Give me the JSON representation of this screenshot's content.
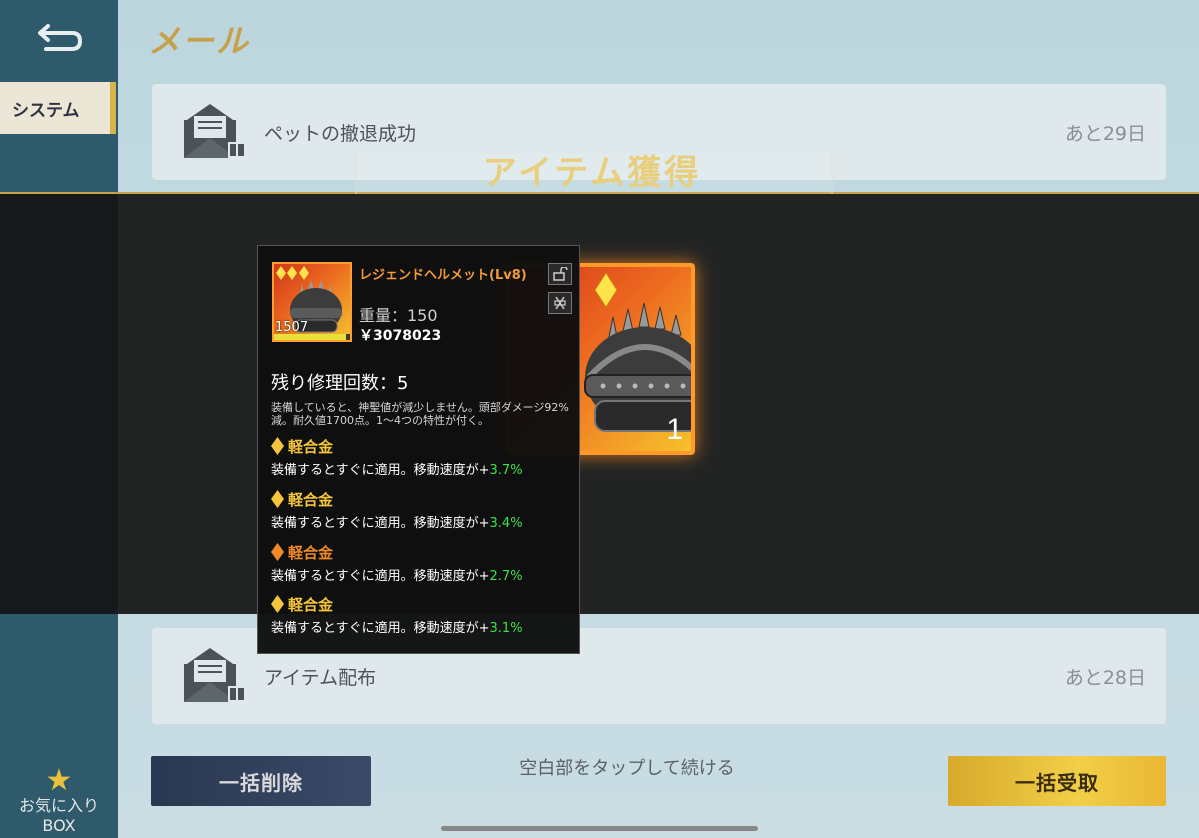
{
  "header": {
    "title": "メール"
  },
  "sidebar": {
    "tab_label": "システム",
    "favorites_label_line1": "お気に入り",
    "favorites_label_line2": "BOX"
  },
  "mail_list": [
    {
      "subject": "ペットの撤退成功",
      "expiry": "あと29日"
    },
    {
      "subject": "アイテム配布",
      "expiry": "あと28日"
    }
  ],
  "overlay": {
    "title": "アイテム獲得",
    "item_quantity": "1",
    "tap_hint": "空白部をタップして続ける"
  },
  "tooltip": {
    "item_name": "レジェンドヘルメット(Lv8)",
    "thumb_number": "1507",
    "durability_fill": 0.95,
    "weight": "重量：150",
    "price": "￥3078023",
    "repair_count": "残り修理回数：5",
    "description": "装備していると、神聖値が減少しません。頭部ダメージ92%減。耐久値1700点。1～4つの特性が付く。",
    "traits": [
      {
        "name": "軽合金",
        "effect": "装備するとすぐに適用。移動速度が+",
        "value": "3.7%",
        "color": "#f5c53a"
      },
      {
        "name": "軽合金",
        "effect": "装備するとすぐに適用。移動速度が+",
        "value": "3.4%",
        "color": "#f5c53a"
      },
      {
        "name": "軽合金",
        "effect": "装備するとすぐに適用。移動速度が+",
        "value": "2.7%",
        "color": "#f08a2a"
      },
      {
        "name": "軽合金",
        "effect": "装備するとすぐに適用。移動速度が+",
        "value": "3.1%",
        "color": "#f5c53a"
      }
    ]
  },
  "buttons": {
    "delete_all": "一括削除",
    "receive_all": "一括受取"
  },
  "colors": {
    "accent_gold": "#d8b24a",
    "rarity_orange": "#ff9a2a",
    "value_green": "#3fe04a"
  },
  "icons": [
    "back-arrow-icon",
    "envelope-gift-icon",
    "lock-icon",
    "discard-icon",
    "star-icon",
    "diamond-rarity-icon",
    "helmet-icon"
  ]
}
